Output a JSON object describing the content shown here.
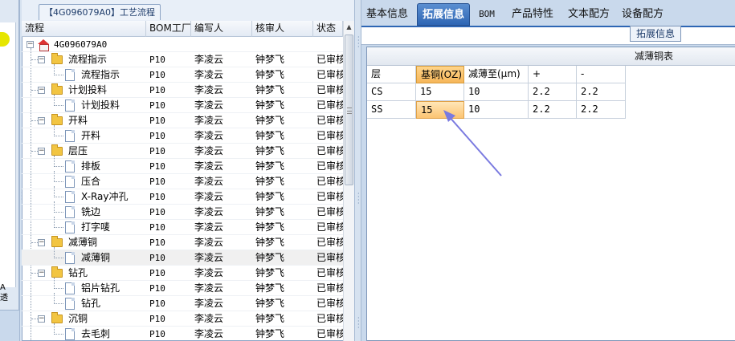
{
  "left_strip": {
    "text_top": "A",
    "text_bottom": "透"
  },
  "tree_panel": {
    "title": "【4G096079A0】工艺流程",
    "columns": [
      "流程",
      "BOM工厂",
      "编写人",
      "核审人",
      "状态"
    ],
    "rows": [
      {
        "label": "4G096079A0",
        "kind": "root",
        "bom": "",
        "writer": "",
        "reviewer": "",
        "status": ""
      },
      {
        "label": "流程指示",
        "kind": "folder",
        "bom": "P10",
        "writer": "李凌云",
        "reviewer": "钟梦飞",
        "status": "已审核"
      },
      {
        "label": "流程指示",
        "kind": "doc",
        "bom": "P10",
        "writer": "李凌云",
        "reviewer": "钟梦飞",
        "status": "已审核"
      },
      {
        "label": "计划投料",
        "kind": "folder",
        "bom": "P10",
        "writer": "李凌云",
        "reviewer": "钟梦飞",
        "status": "已审核"
      },
      {
        "label": "计划投料",
        "kind": "doc",
        "bom": "P10",
        "writer": "李凌云",
        "reviewer": "钟梦飞",
        "status": "已审核"
      },
      {
        "label": "开料",
        "kind": "folder",
        "bom": "P10",
        "writer": "李凌云",
        "reviewer": "钟梦飞",
        "status": "已审核"
      },
      {
        "label": "开料",
        "kind": "doc",
        "bom": "P10",
        "writer": "李凌云",
        "reviewer": "钟梦飞",
        "status": "已审核"
      },
      {
        "label": "层压",
        "kind": "folder",
        "bom": "P10",
        "writer": "李凌云",
        "reviewer": "钟梦飞",
        "status": "已审核"
      },
      {
        "label": "排板",
        "kind": "doc",
        "bom": "P10",
        "writer": "李凌云",
        "reviewer": "钟梦飞",
        "status": "已审核"
      },
      {
        "label": "压合",
        "kind": "doc",
        "bom": "P10",
        "writer": "李凌云",
        "reviewer": "钟梦飞",
        "status": "已审核"
      },
      {
        "label": "X-Ray冲孔",
        "kind": "doc",
        "bom": "P10",
        "writer": "李凌云",
        "reviewer": "钟梦飞",
        "status": "已审核"
      },
      {
        "label": "铣边",
        "kind": "doc",
        "bom": "P10",
        "writer": "李凌云",
        "reviewer": "钟梦飞",
        "status": "已审核"
      },
      {
        "label": "打字唛",
        "kind": "doc",
        "bom": "P10",
        "writer": "李凌云",
        "reviewer": "钟梦飞",
        "status": "已审核"
      },
      {
        "label": "减薄铜",
        "kind": "folder",
        "bom": "P10",
        "writer": "李凌云",
        "reviewer": "钟梦飞",
        "status": "已审核"
      },
      {
        "label": "减薄铜",
        "kind": "doc",
        "bom": "P10",
        "writer": "李凌云",
        "reviewer": "钟梦飞",
        "status": "已审核",
        "selected": true
      },
      {
        "label": "钻孔",
        "kind": "folder",
        "bom": "P10",
        "writer": "李凌云",
        "reviewer": "钟梦飞",
        "status": "已审核"
      },
      {
        "label": "铝片钻孔",
        "kind": "doc",
        "bom": "P10",
        "writer": "李凌云",
        "reviewer": "钟梦飞",
        "status": "已审核"
      },
      {
        "label": "钻孔",
        "kind": "doc",
        "bom": "P10",
        "writer": "李凌云",
        "reviewer": "钟梦飞",
        "status": "已审核"
      },
      {
        "label": "沉铜",
        "kind": "folder",
        "bom": "P10",
        "writer": "李凌云",
        "reviewer": "钟梦飞",
        "status": "已审核"
      },
      {
        "label": "去毛刺",
        "kind": "doc",
        "bom": "P10",
        "writer": "李凌云",
        "reviewer": "钟梦飞",
        "status": "已审核"
      }
    ]
  },
  "tabs": [
    {
      "label": "基本信息",
      "active": false
    },
    {
      "label": "拓展信息",
      "active": true
    },
    {
      "label": "BOM",
      "active": false
    },
    {
      "label": "产品特性",
      "active": false
    },
    {
      "label": "文本配方",
      "active": false
    },
    {
      "label": "设备配方",
      "active": false
    }
  ],
  "sub_tab": {
    "label": "拓展信息"
  },
  "thin_table": {
    "caption": "减薄铜表",
    "headers": [
      "层",
      "基铜(OZ)",
      "减薄至(μm)",
      "+",
      "-"
    ],
    "rows": [
      [
        "CS",
        "15",
        "10",
        "2.2",
        "2.2"
      ],
      [
        "SS",
        "15",
        "10",
        "2.2",
        "2.2"
      ]
    ]
  },
  "colors": {
    "accent": "#2e66b4",
    "highlight": "#f6b659",
    "folder": "#f2c542",
    "arrow": "#7a7ae0"
  }
}
